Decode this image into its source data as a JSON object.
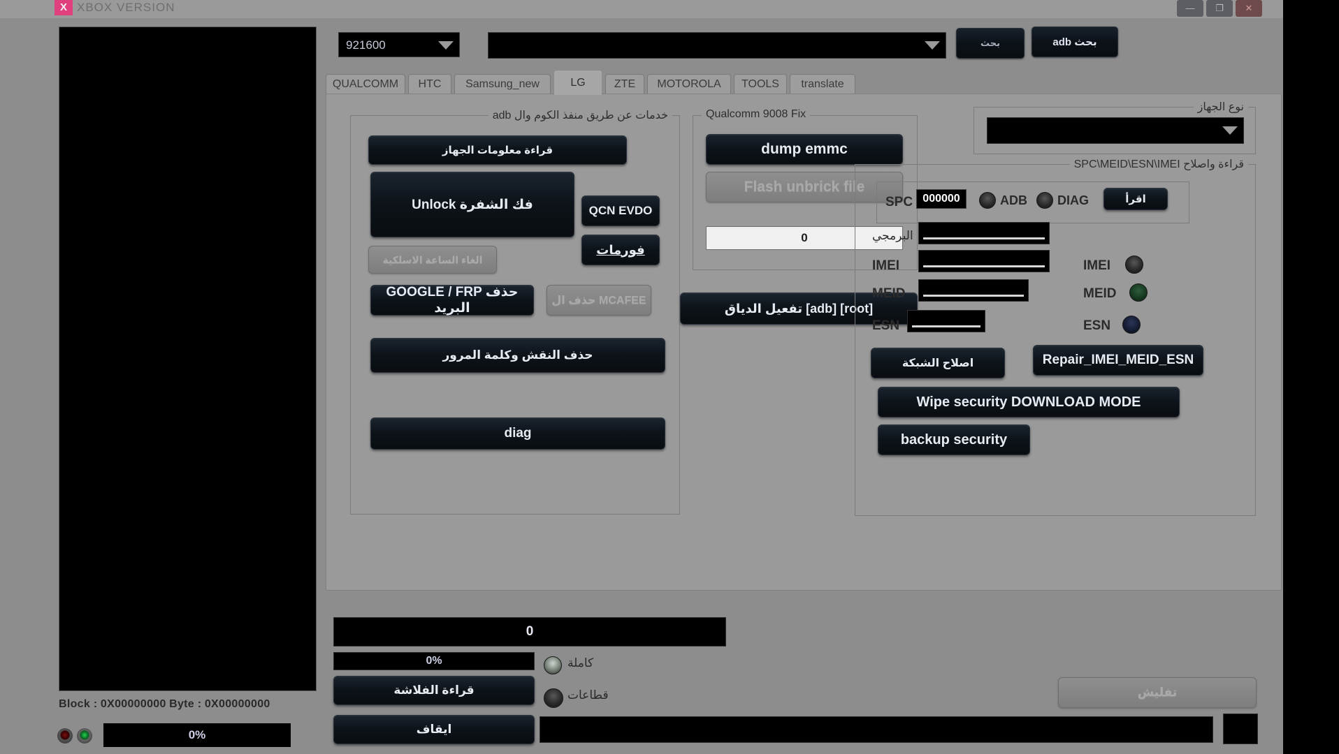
{
  "window": {
    "title": "XBOX VERSION",
    "logo_letter": "X",
    "controls": {
      "minimize": "—",
      "maximize": "❐",
      "close": "✕"
    }
  },
  "toolbar": {
    "baud_value": "921600",
    "port_value": "",
    "search_label": "بحث",
    "search_adb_label": "بحث adb"
  },
  "tabs": [
    {
      "label": "QUALCOMM",
      "active": false
    },
    {
      "label": "HTC",
      "active": false
    },
    {
      "label": "Samsung_new",
      "active": false
    },
    {
      "label": "LG",
      "active": true
    },
    {
      "label": "ZTE",
      "active": false
    },
    {
      "label": "MOTOROLA",
      "active": false
    },
    {
      "label": "TOOLS",
      "active": false
    },
    {
      "label": "translate",
      "active": false
    }
  ],
  "adb_services": {
    "group_title": "خدمات عن طريق منفذ الكوم وال adb",
    "read_device_info": "قراءة معلومات الجهاز",
    "unlock": "Unlock فك الشفرة",
    "qcn_evdo": "QCN EVDO",
    "formats": "فورمات",
    "cancel_wireless_clock": "الغاء الساعة الاسلكية",
    "google_frp": "GOOGLE / FRP حذف البريد",
    "delete_mcafee": "حذف ال MCAFEE",
    "remove_pattern_password": "حذف النقش وكلمة المرور",
    "diag": "diag"
  },
  "qualcomm_fix": {
    "group_title": "Qualcomm 9008 Fix",
    "dump_emmc": "dump emmc",
    "flash_unbrick": "Flash unbrick file",
    "counter_value": "0",
    "root_adb": "[root]  [adb]  تفعيل الدياق"
  },
  "device_type": {
    "group_title": "نوع الجهاز",
    "selected": ""
  },
  "spc_panel": {
    "group_title": "قراءة واصلاح SPC\\MEID\\ESN\\IMEI",
    "spc_label": "SPC",
    "spc_value": "000000",
    "adb_label": "ADB",
    "diag_label": "DIAG",
    "read_button": "اقرأ",
    "sw_label": "البرمجي",
    "sw_value": "",
    "imei_label": "IMEI",
    "imei_value": "",
    "meid_label": "MEID",
    "meid_value": "",
    "esn_label": "ESN",
    "esn_value": "",
    "imei_radio_label": "IMEI",
    "meid_radio_label": "MEID",
    "esn_radio_label": "ESN",
    "repair_network": "اصلاح الشبكة",
    "repair_imei_meid_esn": "Repair_IMEI_MEID_ESN",
    "wipe_security": "Wipe security DOWNLOAD MODE",
    "backup_security": "backup security"
  },
  "bottom": {
    "status_value": "0",
    "progress_percent": "0%",
    "full_label": "كاملة",
    "sectors_label": "قطاعات",
    "read_flash": "قراءة الفلاشة",
    "stop": "ايقاف",
    "flash_button": "تفليش",
    "log_value": ""
  },
  "status_bar": {
    "block_label": "Block :",
    "block_value": "0X00000000",
    "byte_label": "Byte :",
    "byte_value": "0X00000000",
    "progress_percent": "0%"
  },
  "colors": {
    "accent_pink": "#e0407e",
    "panel_gray": "#9a9a9a",
    "button_dark": "#0d1319"
  }
}
